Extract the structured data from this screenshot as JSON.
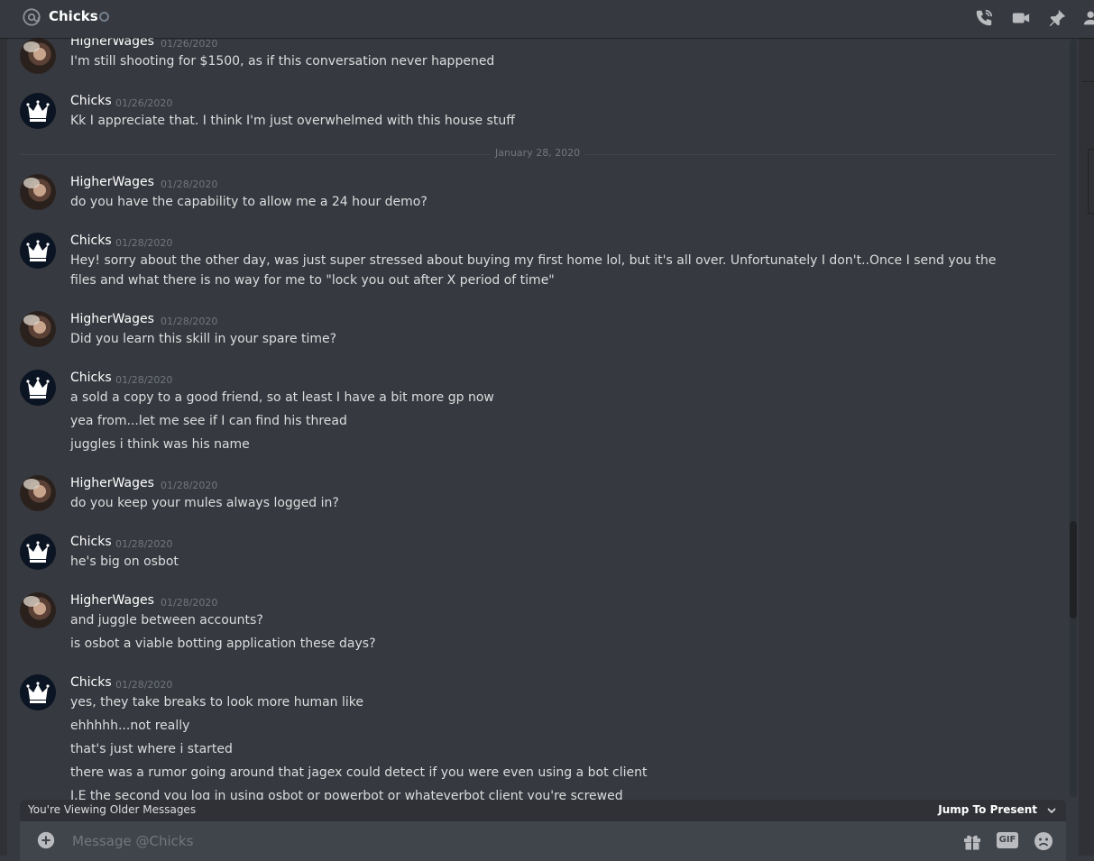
{
  "header": {
    "channel_name": "Chicks"
  },
  "date_divider": {
    "label": "January 28, 2020"
  },
  "messages": [
    {
      "user": "HigherWages",
      "avatar": "photo",
      "time": "01/26/2020",
      "lines": [
        "I'm still shooting for $1500, as if this conversation never happened"
      ]
    },
    {
      "user": "Chicks",
      "avatar": "crown",
      "time": "01/26/2020",
      "lines": [
        "Kk I appreciate that. I think I'm just overwhelmed with this house stuff"
      ]
    },
    {
      "user": "HigherWages",
      "avatar": "photo",
      "time": "01/28/2020",
      "lines": [
        "do you have the capability to allow me a 24 hour demo?"
      ]
    },
    {
      "user": "Chicks",
      "avatar": "crown",
      "time": "01/28/2020",
      "lines": [
        "Hey! sorry about the other day, was just super stressed about buying my first home lol, but it's all over. Unfortunately I don't..Once I send you the files and what there is no way for me to \"lock you out after X period of time\""
      ]
    },
    {
      "user": "HigherWages",
      "avatar": "photo",
      "time": "01/28/2020",
      "lines": [
        "Did you learn this skill in your spare time?"
      ]
    },
    {
      "user": "Chicks",
      "avatar": "crown",
      "time": "01/28/2020",
      "lines": [
        "a sold a copy to a good friend, so at least I have a bit more gp now",
        "yea from...let me see if I can find his thread",
        "juggles i think was his name"
      ]
    },
    {
      "user": "HigherWages",
      "avatar": "photo",
      "time": "01/28/2020",
      "lines": [
        "do you keep your mules always logged in?"
      ]
    },
    {
      "user": "Chicks",
      "avatar": "crown",
      "time": "01/28/2020",
      "lines": [
        "he's big on osbot"
      ]
    },
    {
      "user": "HigherWages",
      "avatar": "photo",
      "time": "01/28/2020",
      "lines": [
        "and juggle between accounts?",
        "is osbot a viable botting application these days?"
      ]
    },
    {
      "user": "Chicks",
      "avatar": "crown",
      "time": "01/28/2020",
      "lines": [
        "yes, they take breaks to look more human like",
        "ehhhhh...not really",
        "that's just where i started",
        "there was a rumor going around that jagex could detect if you were even using a bot client",
        "I.E the second you log in using osbot or powerbot or whateverbot client you're screwed"
      ]
    }
  ],
  "older_bar": {
    "text": "You're Viewing Older Messages",
    "jump": "Jump To Present"
  },
  "composer": {
    "placeholder": "Message @Chicks",
    "gif_label": "GIF"
  },
  "colors": {
    "background": "#36393f",
    "sidebar": "#2f3136",
    "input": "#40444b",
    "muted": "#72767d"
  },
  "icons": [
    "at-icon",
    "status-icon",
    "call-icon",
    "video-icon",
    "pin-icon",
    "members-icon",
    "chevron-down-icon",
    "plus-circle-icon",
    "gift-icon",
    "gif-icon",
    "emoji-icon"
  ]
}
